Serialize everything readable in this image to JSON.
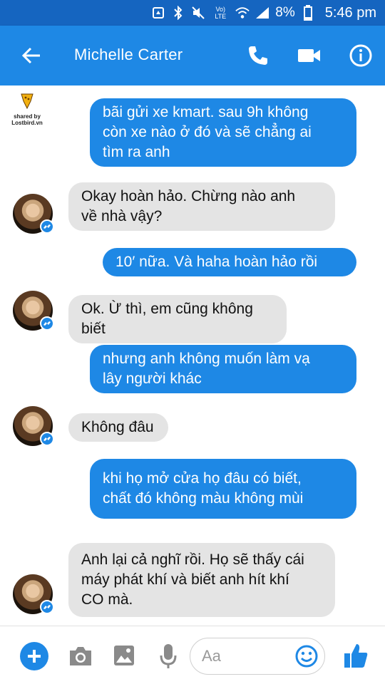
{
  "status_bar": {
    "network_label": "Vo) LTE",
    "battery_percent": "8%",
    "time": "5:46 pm"
  },
  "header": {
    "contact_name": "Michelle Carter"
  },
  "watermark": {
    "text_line1": "shared by",
    "text_line2": "Lostbird.vn"
  },
  "messages": [
    {
      "direction": "out",
      "text_lines": [
        "bãi gửi xe kmart. sau 9h không",
        "còn xe nào ở đó và sẽ chẳng ai",
        "tìm ra anh"
      ]
    },
    {
      "direction": "in",
      "text_lines": [
        "Okay hoàn hảo. Chừng nào anh",
        "về nhà vậy?"
      ]
    },
    {
      "direction": "out",
      "text_lines": [
        "10′ nữa. Và haha hoàn hảo rồi"
      ]
    },
    {
      "direction": "in",
      "text_lines": [
        "Ok. Ừ thì, em cũng không biết"
      ]
    },
    {
      "direction": "out",
      "text_lines": [
        "nhưng anh không muốn làm vạ",
        "lây người khác"
      ]
    },
    {
      "direction": "in",
      "text_lines": [
        "Không đâu"
      ]
    },
    {
      "direction": "out",
      "text_lines": [
        "khi họ mở cửa họ đâu có biết,",
        "chất đó không màu không mùi"
      ]
    },
    {
      "direction": "in",
      "text_lines": [
        "Anh lại cả nghĩ rồi. Họ sẽ thấy cái",
        "máy phát khí và biết anh hít khí",
        "CO mà."
      ]
    }
  ],
  "composer": {
    "placeholder": "Aa"
  },
  "colors": {
    "status_bar": "#1565c0",
    "header": "#1e88e5",
    "outgoing_bubble": "#1e88e5",
    "incoming_bubble": "#e4e4e4"
  },
  "icons": {
    "back": "arrow-left-icon",
    "call": "phone-icon",
    "video": "video-camera-icon",
    "info": "info-icon",
    "plus": "plus-icon",
    "camera": "camera-icon",
    "image": "image-icon",
    "mic": "microphone-icon",
    "emoji": "emoji-icon",
    "like": "thumbs-up-icon"
  }
}
